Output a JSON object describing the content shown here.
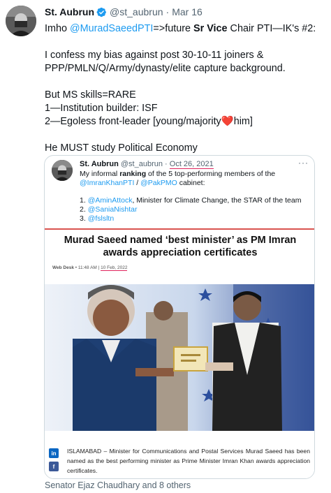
{
  "tweet": {
    "display_name": "St. Aubrun",
    "handle": "@st_aubrun",
    "separator": "·",
    "date": "Mar 16",
    "line1_pre": "Imho ",
    "line1_mention": "@MuradSaeedPTI",
    "line1_mid": "=>future ",
    "line1_bold": "Sr Vice",
    "line1_post": " Chair PTI—IK's #2:",
    "para2": "I confess my bias against post 30-10-11 joiners & PPP/PMLN/Q/Army/dynasty/elite capture background.",
    "para3_line1": "But MS skills=RARE",
    "para3_line2": "1—Institution builder: ISF",
    "para3_line3_pre": "2—Egoless front-leader [young/majority",
    "para3_line3_emoji": "❤️",
    "para3_line3_post": "him]",
    "para4": "He MUST study Political Economy"
  },
  "quoted": {
    "display_name": "St. Aubrun",
    "handle": "@st_aubrun",
    "separator": "·",
    "date": "Oct 26, 2021",
    "more": "···",
    "intro_pre": "My informal ",
    "intro_bold": "ranking",
    "intro_post": " of the 5 top-performing members of the",
    "mention_pti": "@ImranKhanPTI",
    "slash": " / ",
    "mention_pmo": "@PakPMO",
    "cabinet": " cabinet:",
    "item1_num": "1. ",
    "item1_mention": "@AminAttock",
    "item1_text": ", Minister for Climate Change, the STAR of the team",
    "item2_num": "2. ",
    "item2_mention": "@SaniaNishtar",
    "item3_num": "3. ",
    "item3_mention": "@fslsltn"
  },
  "article": {
    "title_line1": "Murad Saeed named ‘best minister’ as PM Imran",
    "title_line2": "awards appreciation certificates",
    "byline": "Web Desk",
    "time": "• 11:48 AM |",
    "date": "10 Feb, 2022",
    "body": "ISLAMABAD – Minister for Communications and Postal Services Murad Saeed has been named as the best performing minister as Prime Minister Imran Khan awards appreciation certificates.",
    "linkedin_label": "in",
    "facebook_label": "f",
    "linkedin_color": "#0a66c2",
    "facebook_color": "#3b5998"
  },
  "liked_by": "Senator Ejaz Chaudhary and 8 others",
  "icons": {
    "verified": "verified-badge-icon",
    "linkedin": "linkedin-icon",
    "facebook": "facebook-icon"
  },
  "colors": {
    "link": "#1d9bf0",
    "secondary_text": "#536471",
    "accent_red": "#d9534f"
  }
}
